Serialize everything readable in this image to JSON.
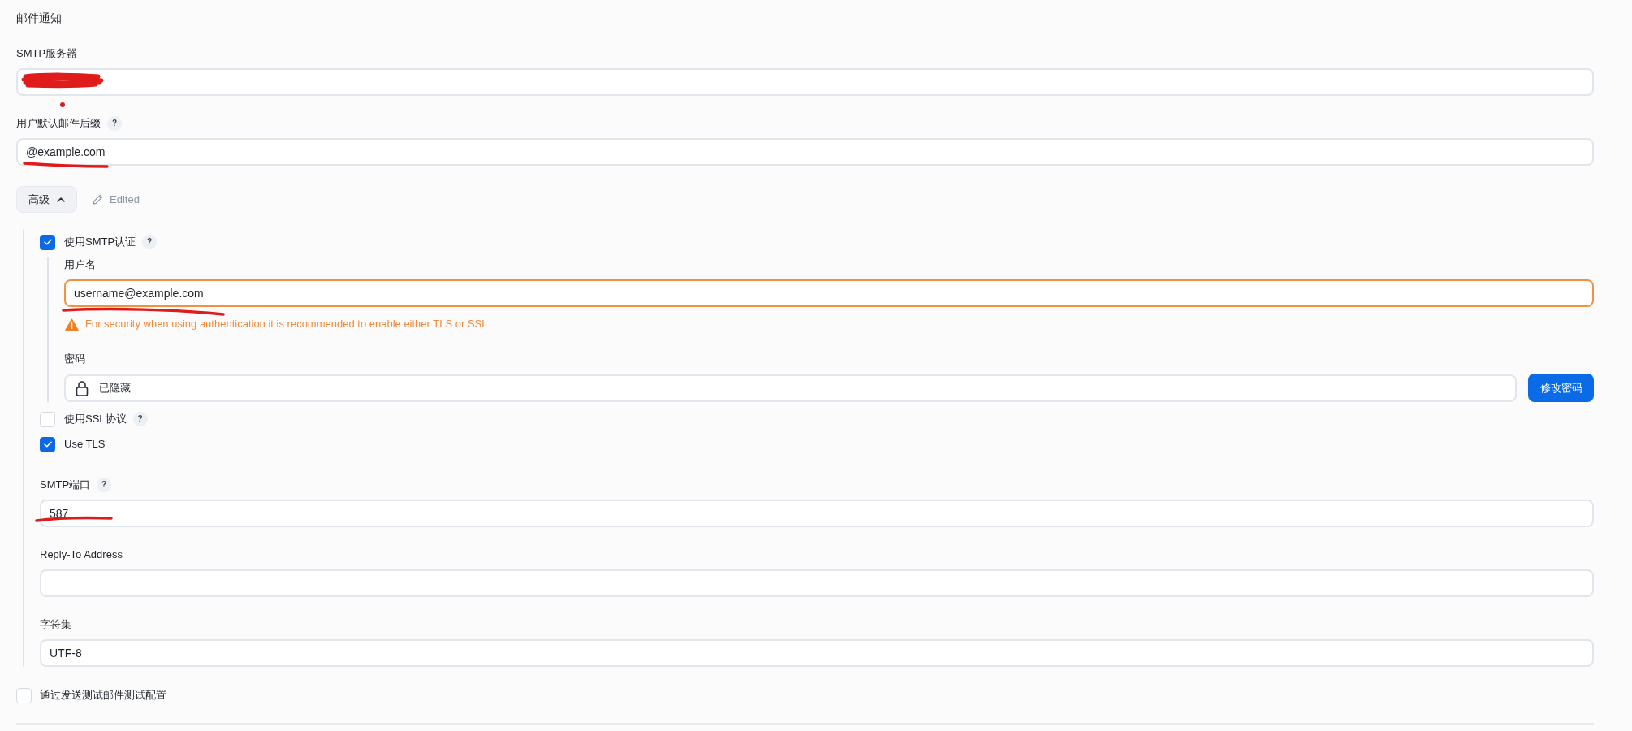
{
  "section_title": "邮件通知",
  "fields": [
    {
      "kind": "text",
      "label": "SMTP服务器"
    },
    {
      "kind": "text",
      "label": "用户默认邮件后缀",
      "help": "?",
      "value": "@example.com"
    }
  ],
  "advanced": {
    "label": "高级",
    "expanded": true,
    "edited_label": "Edited",
    "fields": [
      {
        "kind": "checkbox",
        "label": "使用SMTP认证",
        "help": "?",
        "checked": true,
        "children": [
          {
            "kind": "text",
            "label": "用户名",
            "value": "username@example.com",
            "warning": "For security when using authentication it is recommended to enable either TLS or SSL"
          },
          {
            "kind": "password",
            "label": "密码",
            "value": "已隐藏",
            "button": "修改密码"
          }
        ]
      },
      {
        "kind": "checkbox",
        "label": "使用SSL协议",
        "help": "?",
        "checked": false
      },
      {
        "kind": "checkbox",
        "label": "Use TLS",
        "checked": true
      },
      {
        "kind": "text",
        "label": "SMTP端口",
        "help": "?",
        "value": "587"
      },
      {
        "kind": "text",
        "label": "Reply-To Address"
      },
      {
        "kind": "text",
        "label": "字符集",
        "value": "UTF-8"
      }
    ]
  },
  "test_config": {
    "label": "通过发送测试邮件测试配置",
    "checked": false
  }
}
